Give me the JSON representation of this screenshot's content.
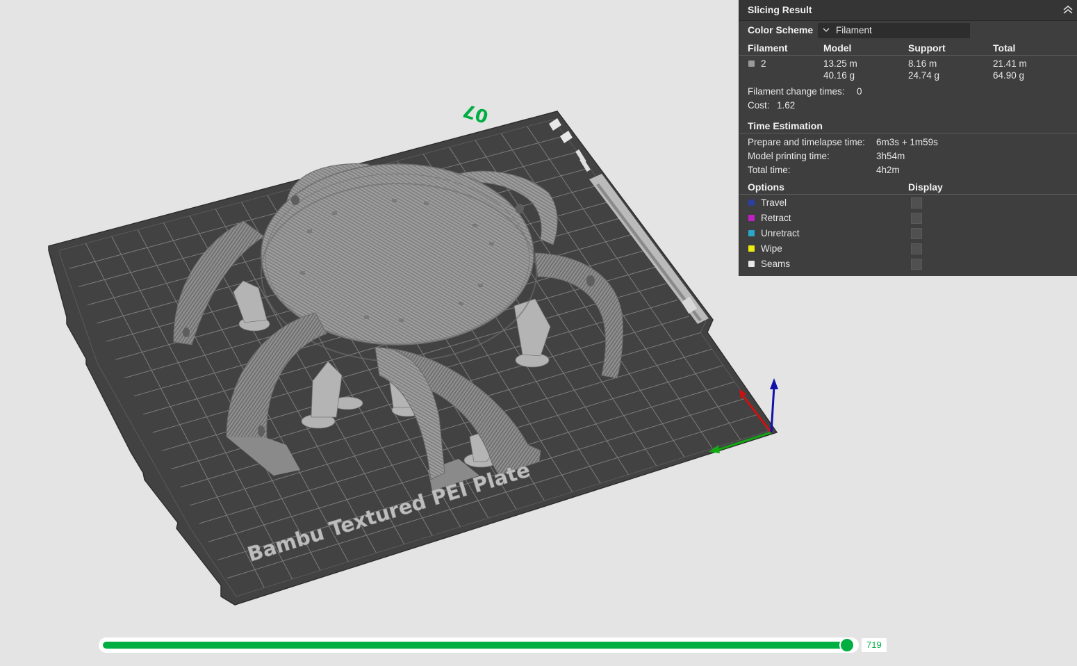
{
  "plate": {
    "name": "Bambu Textured PEI Plate",
    "number": "07"
  },
  "panel": {
    "title": "Slicing Result",
    "color_scheme_label": "Color Scheme",
    "color_scheme_value": "Filament",
    "table_headers": [
      "Filament",
      "Model",
      "Support",
      "Total"
    ],
    "filament": {
      "id": "2",
      "color": "#9a9a9a",
      "model_length": "13.25 m",
      "model_weight": "40.16 g",
      "support_length": "8.16 m",
      "support_weight": "24.74 g",
      "total_length": "21.41 m",
      "total_weight": "64.90 g"
    },
    "change_times_label": "Filament change times:",
    "change_times_value": "0",
    "cost_label": "Cost:",
    "cost_value": "1.62",
    "time_title": "Time Estimation",
    "prepare_label": "Prepare and timelapse time:",
    "prepare_value": "6m3s + 1m59s",
    "model_time_label": "Model printing time:",
    "model_time_value": "3h54m",
    "total_time_label": "Total time:",
    "total_time_value": "4h2m",
    "options_label": "Options",
    "display_label": "Display",
    "options": [
      {
        "label": "Travel",
        "color": "#2c3e9e"
      },
      {
        "label": "Retract",
        "color": "#c21ec8"
      },
      {
        "label": "Unretract",
        "color": "#2aa8c8"
      },
      {
        "label": "Wipe",
        "color": "#ecec10"
      },
      {
        "label": "Seams",
        "color": "#e8e8e8"
      }
    ]
  },
  "layer_slider": {
    "value": "719"
  },
  "colors": {
    "accent": "#00ae42",
    "background": "#e4e4e4",
    "plate": "#424242",
    "model": "#a4a4a4"
  }
}
